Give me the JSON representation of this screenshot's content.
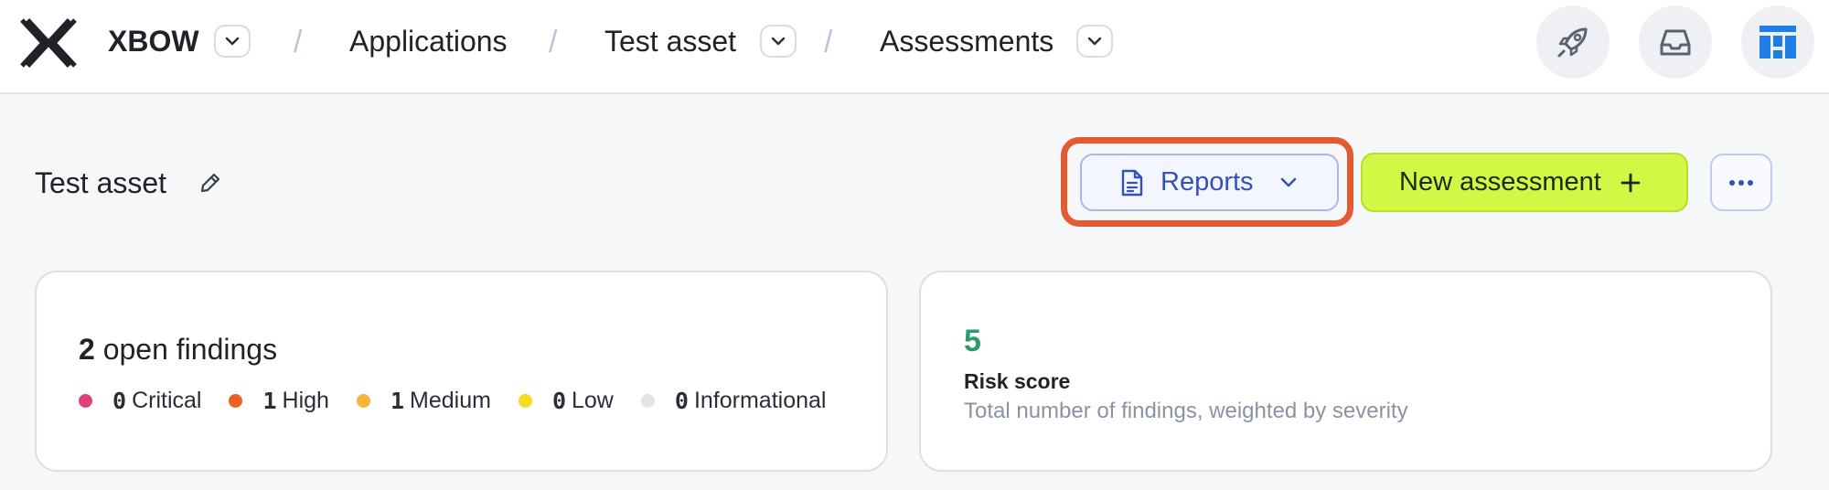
{
  "header": {
    "brand": "XBOW",
    "separator": "/",
    "breadcrumbs": [
      {
        "label": "Applications"
      },
      {
        "label": "Test asset"
      },
      {
        "label": "Assessments"
      }
    ],
    "icons": {
      "logo": "xbow-logo",
      "launch": "rocket-icon",
      "inbox": "inbox-icon",
      "avatar": "org-avatar-icon"
    },
    "avatar_color": "#1f7ee6"
  },
  "page": {
    "title": "Test asset",
    "edit_icon": "pencil-icon"
  },
  "toolbar": {
    "reports_label": "Reports",
    "new_assessment_label": "New assessment",
    "new_assessment_icon": "plus-icon",
    "more_icon": "ellipsis-icon",
    "accent_color": "#d2f745",
    "highlight_color": "#e35a33"
  },
  "findings": {
    "count": "2",
    "label": "open findings",
    "severities": [
      {
        "count": "0",
        "label": "Critical",
        "color": "#e0407a"
      },
      {
        "count": "1",
        "label": "High",
        "color": "#ec6023"
      },
      {
        "count": "1",
        "label": "Medium",
        "color": "#f6b43a"
      },
      {
        "count": "0",
        "label": "Low",
        "color": "#f2dd22"
      },
      {
        "count": "0",
        "label": "Informational",
        "color": "#e3e4e8"
      }
    ]
  },
  "risk": {
    "value": "5",
    "label": "Risk score",
    "description": "Total number of findings, weighted by severity",
    "value_color": "#2a9a6f"
  }
}
